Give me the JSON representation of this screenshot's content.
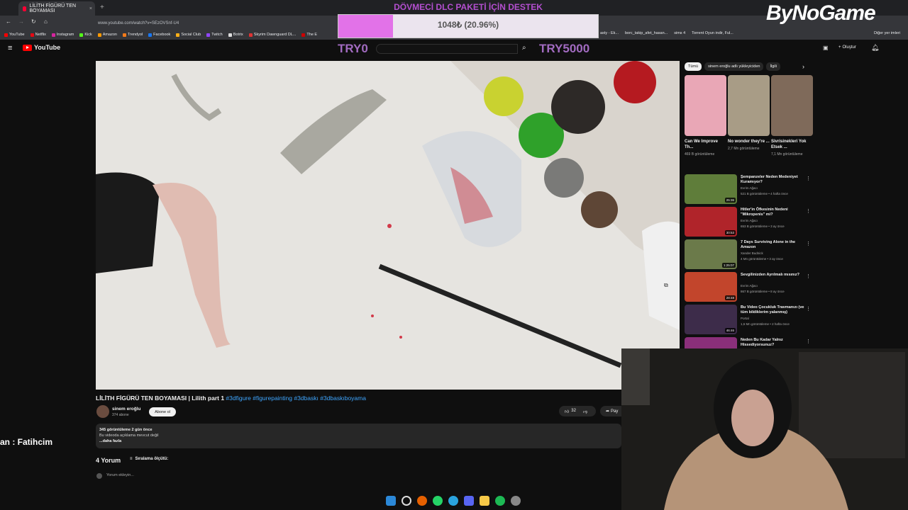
{
  "browser": {
    "tab_title": "LİLİTH FİGÜRÜ TEN BOYAMASI",
    "url": "www.youtube.com/watch?v=SEzOVSnf-U4",
    "bookmarks": [
      "YouTube",
      "Netflix",
      "Instagram",
      "Kick",
      "Amazon",
      "Trendyol",
      "Facebook",
      "Social Club",
      "Twitch",
      "Botrix",
      "Skyrim Dawnguard DL...",
      "The E"
    ],
    "bookmarks_right": [
      "asty - Ek...",
      "borc_takip_afet_hasan...",
      "sims 4",
      "Torrent Oyun indir, Ful...",
      "Diğer yer imleri"
    ]
  },
  "youtube": {
    "logo_text": "YouTube",
    "create_label": "Oluştur"
  },
  "stream_overlay": {
    "goal_title": "DÖVMECİ DLC PAKETİ İÇİN DESTEK",
    "goal_progress_text": "1048₺ (20.96%)",
    "goal_progress": 0.2096,
    "goal_min": "TRY0",
    "goal_max": "TRY5000",
    "brand": "ByNoGame",
    "chat_message": "an : Fatihcim"
  },
  "video": {
    "title": "LİLİTH FİGÜRÜ TEN BOYAMASI | Lilith part 1",
    "hashtags": "#3dfigure #figurepainting #3dbaskı #3dbaskıboyama",
    "channel_name": "sinem eroğlu",
    "channel_subs": "374 abone",
    "subscribe_label": "Abone ol",
    "likes": "32",
    "share_label": "Pay",
    "views_time": "345 görüntüleme  2 gün önce",
    "desc_line": "Bu videoda açıklama mevcut değil",
    "more": "...daha fazla",
    "comments_count": "4 Yorum",
    "sort_label": "Sıralama ölçütü:",
    "add_comment": "Yorum ekleyin..."
  },
  "sidebar": {
    "chips": [
      "Tümü",
      "sinem eroğlu adlı yükleyiciden",
      "İlgili"
    ],
    "shorts": [
      {
        "title": "Can We Improve Th...",
        "views": "469 B görüntüleme",
        "color": "#e9a7b6"
      },
      {
        "title": "No wonder they're ...",
        "views": "2,7 Mn görüntüleme",
        "color": "#a89c86"
      },
      {
        "title": "Sivrisinekleri Yok Etsek ...",
        "views": "7,1 Mn görüntüleme",
        "color": "#7f6a5a"
      }
    ],
    "recommended": [
      {
        "title": "Şempanzeler Neden Medeniyet Kuramıyor?",
        "channel": "Evrim Ağacı",
        "meta": "521 B görüntüleme • 4 hafta önce",
        "duration": "25:36",
        "color": "#5f7d3a"
      },
      {
        "title": "Hitler'in Öfkesinin Nedeni \"Mikropenis\" mi?",
        "channel": "Evrim Ağacı",
        "meta": "653 B görüntüleme • 3 ay önce",
        "duration": "30:53",
        "color": "#b0242a"
      },
      {
        "title": "7 Days Surviving Alone in the Amazon",
        "channel": "Xander Budnick",
        "meta": "4 Mn görüntüleme • 3 ay önce",
        "duration": "1:25:07",
        "color": "#6b7a4a"
      },
      {
        "title": "Sevgilinizden Ayrılmalı mısınız?",
        "channel": "Evrim Ağacı",
        "meta": "867 B görüntüleme • 8 ay önce",
        "duration": "28:48",
        "color": "#c2452c"
      },
      {
        "title": "Bu Video Çocukluk Travmanızı (ve tüm bildiklerim yalanmış)",
        "channel": "Portal",
        "meta": "1,6 Mn görüntüleme • 2 hafta önce",
        "duration": "46:46",
        "color": "#3d2c4a"
      },
      {
        "title": "Neden Bu Kadar Yalnız Hissediyorsunuz?",
        "channel": "",
        "meta": "",
        "duration": "",
        "color": "#8a2f7a"
      }
    ]
  },
  "colors": {
    "yt_red": "#ff0000",
    "link_blue": "#3ea6ff",
    "goal_purple": "#b44fd0"
  }
}
